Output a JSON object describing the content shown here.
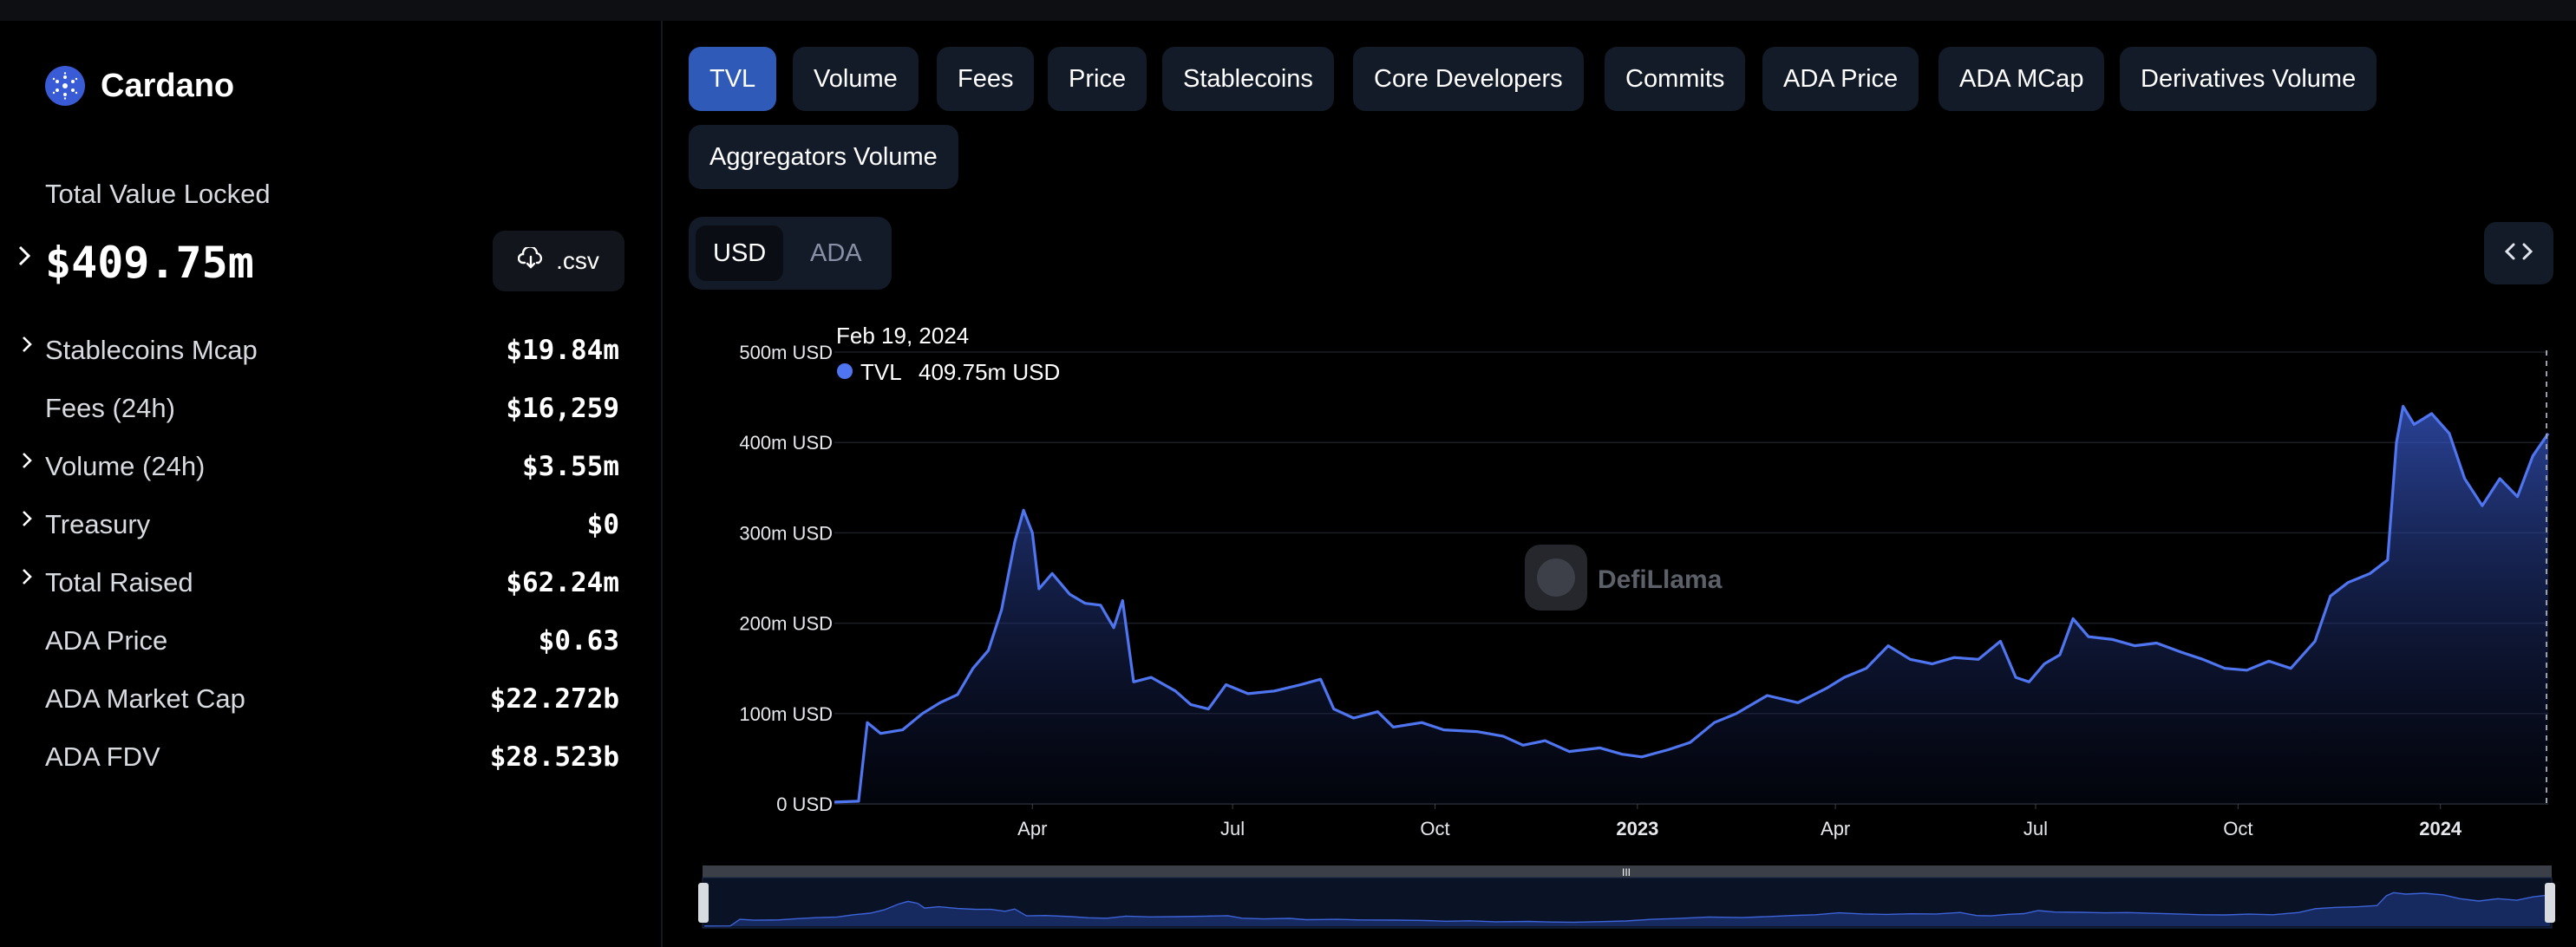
{
  "sidebar": {
    "chain_name": "Cardano",
    "tvl_label": "Total Value Locked",
    "tvl_value": "$409.75m",
    "csv_label": ".csv",
    "stats": [
      {
        "label": "Stablecoins Mcap",
        "value": "$19.84m",
        "expandable": true
      },
      {
        "label": "Fees (24h)",
        "value": "$16,259",
        "expandable": false
      },
      {
        "label": "Volume (24h)",
        "value": "$3.55m",
        "expandable": true
      },
      {
        "label": "Treasury",
        "value": "$0",
        "expandable": true
      },
      {
        "label": "Total Raised",
        "value": "$62.24m",
        "expandable": true
      },
      {
        "label": "ADA Price",
        "value": "$0.63",
        "expandable": false
      },
      {
        "label": "ADA Market Cap",
        "value": "$22.272b",
        "expandable": false
      },
      {
        "label": "ADA FDV",
        "value": "$28.523b",
        "expandable": false
      }
    ]
  },
  "tabs": [
    {
      "label": "TVL",
      "active": true
    },
    {
      "label": "Volume"
    },
    {
      "label": "Fees"
    },
    {
      "label": "Price"
    },
    {
      "label": "Stablecoins"
    },
    {
      "label": "Core Developers"
    },
    {
      "label": "Commits"
    },
    {
      "label": "ADA Price"
    },
    {
      "label": "ADA MCap"
    },
    {
      "label": "Derivatives Volume"
    },
    {
      "label": "Aggregators Volume"
    }
  ],
  "unit_toggle": {
    "options": [
      "USD",
      "ADA"
    ],
    "selected": "USD"
  },
  "watermark": "DefiLlama",
  "tooltip": {
    "date": "Feb 19, 2024",
    "series": "TVL",
    "value": "409.75m USD"
  },
  "colors": {
    "accent": "#2f5ab8",
    "series": "#4f76f0"
  },
  "chart_data": {
    "type": "area",
    "title": "",
    "series_name": "TVL",
    "y_unit": "USD",
    "ylim": [
      0,
      500
    ],
    "y_ticks": [
      "0 USD",
      "100m USD",
      "200m USD",
      "300m USD",
      "400m USD",
      "500m USD"
    ],
    "x_tick_labels": [
      "Apr",
      "Jul",
      "Oct",
      "2023",
      "Apr",
      "Jul",
      "Oct",
      "2024"
    ],
    "xlim": [
      "2022-01-01",
      "2024-02-19"
    ],
    "grid": true,
    "points": [
      [
        "2022-01-01",
        2
      ],
      [
        "2022-01-12",
        3
      ],
      [
        "2022-01-16",
        90
      ],
      [
        "2022-01-22",
        78
      ],
      [
        "2022-02-01",
        82
      ],
      [
        "2022-02-10",
        100
      ],
      [
        "2022-02-18",
        112
      ],
      [
        "2022-02-26",
        121
      ],
      [
        "2022-03-05",
        150
      ],
      [
        "2022-03-12",
        170
      ],
      [
        "2022-03-18",
        215
      ],
      [
        "2022-03-24",
        290
      ],
      [
        "2022-03-28",
        325
      ],
      [
        "2022-04-01",
        300
      ],
      [
        "2022-04-04",
        238
      ],
      [
        "2022-04-10",
        255
      ],
      [
        "2022-04-18",
        232
      ],
      [
        "2022-04-25",
        222
      ],
      [
        "2022-05-02",
        220
      ],
      [
        "2022-05-08",
        195
      ],
      [
        "2022-05-12",
        225
      ],
      [
        "2022-05-17",
        135
      ],
      [
        "2022-05-25",
        140
      ],
      [
        "2022-06-05",
        125
      ],
      [
        "2022-06-12",
        110
      ],
      [
        "2022-06-20",
        105
      ],
      [
        "2022-06-28",
        132
      ],
      [
        "2022-07-08",
        122
      ],
      [
        "2022-07-20",
        125
      ],
      [
        "2022-08-01",
        132
      ],
      [
        "2022-08-10",
        138
      ],
      [
        "2022-08-16",
        105
      ],
      [
        "2022-08-25",
        95
      ],
      [
        "2022-09-05",
        102
      ],
      [
        "2022-09-12",
        85
      ],
      [
        "2022-09-25",
        90
      ],
      [
        "2022-10-05",
        82
      ],
      [
        "2022-10-20",
        80
      ],
      [
        "2022-11-01",
        75
      ],
      [
        "2022-11-10",
        65
      ],
      [
        "2022-11-20",
        70
      ],
      [
        "2022-12-01",
        58
      ],
      [
        "2022-12-15",
        62
      ],
      [
        "2022-12-25",
        55
      ],
      [
        "2023-01-03",
        52
      ],
      [
        "2023-01-15",
        60
      ],
      [
        "2023-01-25",
        68
      ],
      [
        "2023-02-05",
        90
      ],
      [
        "2023-02-15",
        100
      ],
      [
        "2023-03-01",
        120
      ],
      [
        "2023-03-15",
        112
      ],
      [
        "2023-03-28",
        128
      ],
      [
        "2023-04-05",
        140
      ],
      [
        "2023-04-15",
        150
      ],
      [
        "2023-04-25",
        175
      ],
      [
        "2023-05-05",
        160
      ],
      [
        "2023-05-15",
        155
      ],
      [
        "2023-05-25",
        162
      ],
      [
        "2023-06-05",
        160
      ],
      [
        "2023-06-15",
        180
      ],
      [
        "2023-06-22",
        140
      ],
      [
        "2023-06-28",
        135
      ],
      [
        "2023-07-05",
        155
      ],
      [
        "2023-07-12",
        165
      ],
      [
        "2023-07-18",
        205
      ],
      [
        "2023-07-25",
        185
      ],
      [
        "2023-08-05",
        182
      ],
      [
        "2023-08-15",
        175
      ],
      [
        "2023-08-25",
        178
      ],
      [
        "2023-09-05",
        168
      ],
      [
        "2023-09-15",
        160
      ],
      [
        "2023-09-25",
        150
      ],
      [
        "2023-10-05",
        148
      ],
      [
        "2023-10-15",
        158
      ],
      [
        "2023-10-25",
        150
      ],
      [
        "2023-11-05",
        180
      ],
      [
        "2023-11-12",
        230
      ],
      [
        "2023-11-20",
        245
      ],
      [
        "2023-11-30",
        255
      ],
      [
        "2023-12-08",
        270
      ],
      [
        "2023-12-12",
        400
      ],
      [
        "2023-12-15",
        440
      ],
      [
        "2023-12-20",
        420
      ],
      [
        "2023-12-28",
        432
      ],
      [
        "2024-01-05",
        410
      ],
      [
        "2024-01-12",
        360
      ],
      [
        "2024-01-20",
        330
      ],
      [
        "2024-01-28",
        360
      ],
      [
        "2024-02-05",
        340
      ],
      [
        "2024-02-12",
        385
      ],
      [
        "2024-02-19",
        410
      ]
    ]
  }
}
